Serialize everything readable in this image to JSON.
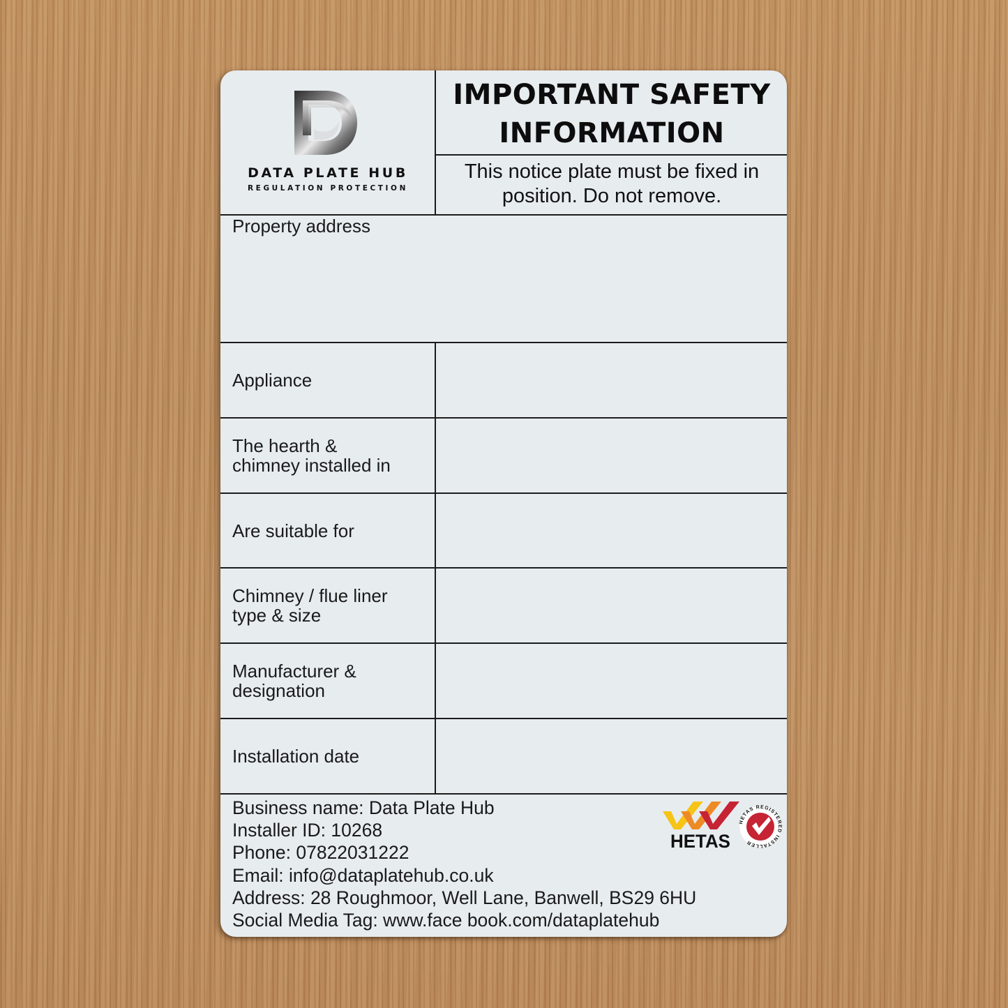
{
  "plate": {
    "brand": {
      "name": "DATA PLATE HUB",
      "tagline": "REGULATION PROTECTION",
      "logo_icon": "dph-d-monogram-icon"
    },
    "header": {
      "title_line1": "IMPORTANT SAFETY",
      "title_line2": "INFORMATION",
      "notice_line1": "This notice plate must be fixed in",
      "notice_line2": "position. Do not remove."
    },
    "property_address": {
      "label": "Property address",
      "value": ""
    },
    "fields": [
      {
        "label_lines": [
          "Appliance"
        ],
        "value": ""
      },
      {
        "label_lines": [
          "The hearth &",
          "chimney installed in"
        ],
        "value": ""
      },
      {
        "label_lines": [
          "Are suitable for"
        ],
        "value": ""
      },
      {
        "label_lines": [
          "Chimney / flue liner",
          "type & size"
        ],
        "value": ""
      },
      {
        "label_lines": [
          "Manufacturer &",
          "designation"
        ],
        "value": ""
      },
      {
        "label_lines": [
          "Installation date"
        ],
        "value": ""
      }
    ],
    "footer": {
      "business_name": "Business name: Data Plate Hub",
      "installer_id": "Installer ID: 10268",
      "phone": "Phone: 07822031222",
      "email": "Email: info@dataplatehub.co.uk",
      "address": "Address: 28 Roughmoor, Well Lane, Banwell, BS29 6HU",
      "social": "Social Media Tag: www.face book.com/dataplatehub"
    },
    "certification": {
      "name": "HETAS",
      "badge_text": "HETAS REGISTERED INSTALLER",
      "badge_icon": "registered-installer-check-icon",
      "colors": {
        "yellow": "#f6c417",
        "orange": "#ee8a25",
        "red": "#c62334",
        "black": "#111111"
      }
    }
  }
}
